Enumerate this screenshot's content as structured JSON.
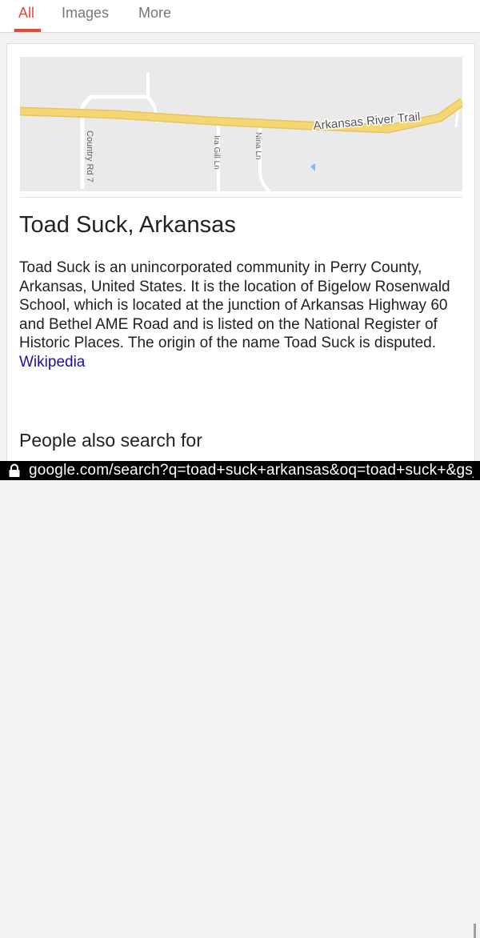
{
  "tabs": [
    {
      "label": "All",
      "active": true
    },
    {
      "label": "Images",
      "active": false
    },
    {
      "label": "More",
      "active": false
    }
  ],
  "colors": {
    "accent": "#dd4b39",
    "link": "#1a0dab",
    "highway": "#f4d675",
    "map_background": "#eaeaea",
    "water_marker": "#8ab4f8"
  },
  "map": {
    "trail_label": "Arkansas River Trail",
    "roads": [
      "Country Rd 7",
      "Ira Gill Ln",
      "Nina Ln"
    ]
  },
  "result": {
    "title": "Toad Suck, Arkansas",
    "description": "Toad Suck is an unincorporated community in Perry County, Arkansas, United States. It is the location of Bigelow Rosenwald School, which is located at the junction of Arkansas Highway 60 and Bethel AME Road and is listed on the National Register of Historic Places. The origin of the name Toad Suck is disputed.",
    "source": "Wikipedia"
  },
  "people_also_search": {
    "heading": "People also search for"
  },
  "address_bar": {
    "url": "google.com/search?q=toad+suck+arkansas&oq=toad+suck+&gs_"
  }
}
